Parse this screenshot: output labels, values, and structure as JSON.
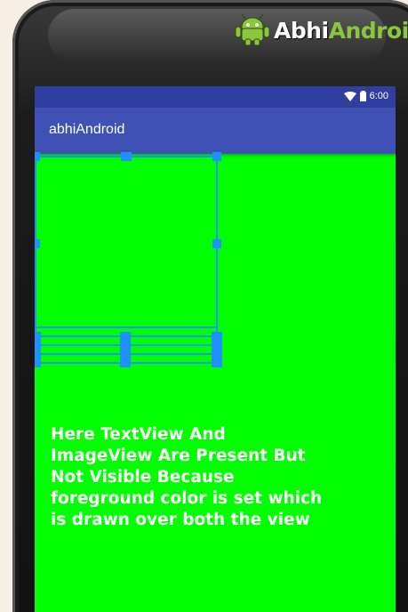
{
  "brand": {
    "logo_part1": "Abhi",
    "logo_part2": "Android",
    "logo_icon": "android-robot-icon"
  },
  "status_bar": {
    "time": "6:00",
    "icons": [
      "wifi-icon",
      "battery-icon"
    ]
  },
  "action_bar": {
    "title": "abhiAndroid"
  },
  "colors": {
    "status_bar": "#303f9f",
    "action_bar": "#3f51b5",
    "foreground": "#00ff00",
    "selection": "#1e90ff",
    "text": "#ffffff"
  },
  "content": {
    "message": "Here TextView And\nImageView Are Present But\nNot Visible Because\nforeground color is set which\nis drawn over both the view"
  }
}
